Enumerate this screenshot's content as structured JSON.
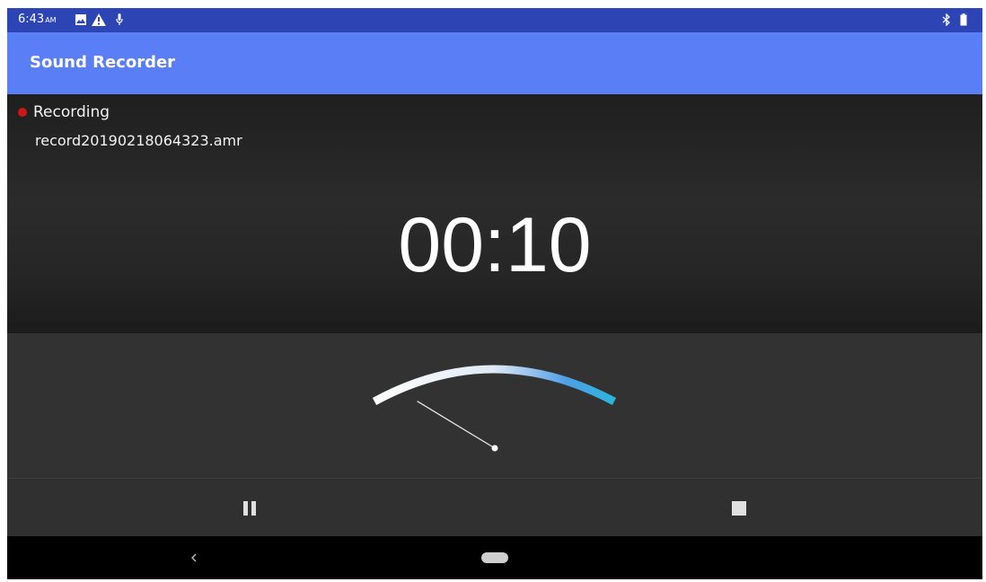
{
  "status_bar": {
    "time": "6:43",
    "time_suffix": "AM",
    "icons_left": [
      "image-icon",
      "warning-icon",
      "microphone-icon"
    ],
    "icons_right": [
      "bluetooth-icon",
      "battery-icon"
    ],
    "color": "#2d44b4"
  },
  "app_bar": {
    "title": "Sound Recorder",
    "color": "#5a7ef6"
  },
  "recording": {
    "state": "Recording",
    "file_name": "record20190218064323.amr",
    "elapsed": "00:10",
    "indicator_color": "#c81818"
  },
  "level_meter": {
    "level": 0.08,
    "arc_colors": [
      "#ffffff",
      "#2aa7e0"
    ]
  },
  "controls": {
    "pause_icon": "pause-icon",
    "stop_icon": "stop-icon"
  },
  "nav_bar": {
    "back_icon": "back-chevron-icon",
    "home_icon": "home-pill-icon"
  }
}
